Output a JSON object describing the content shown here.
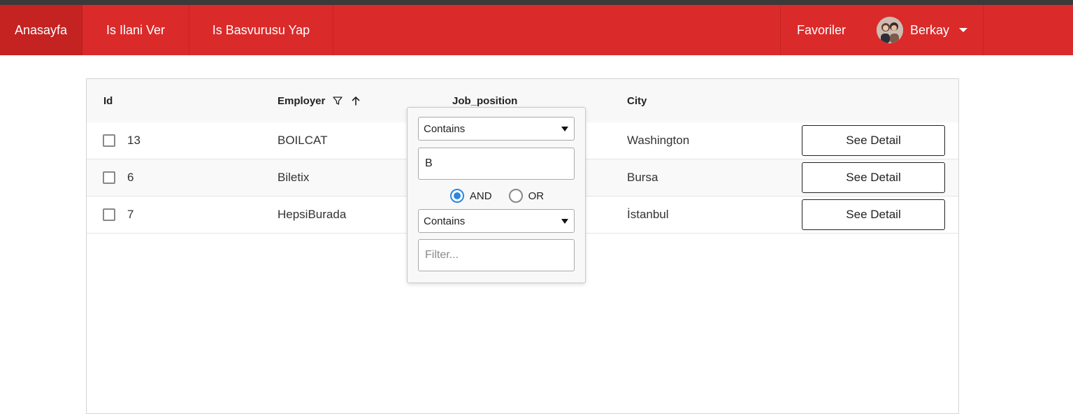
{
  "navbar": {
    "home": "Anasayfa",
    "post_job": "Is Ilani Ver",
    "apply_job": "Is Basvurusu Yap",
    "favorites": "Favoriler",
    "user_name": "Berkay",
    "bg_color": "#db2a2a"
  },
  "table": {
    "columns": {
      "id": "Id",
      "employer": "Employer",
      "job_position": "Job_position",
      "city": "City"
    },
    "rows": [
      {
        "id": "13",
        "employer": "BOILCAT",
        "city": "Washington",
        "action": "See Detail"
      },
      {
        "id": "6",
        "employer": "Biletix",
        "city": "Bursa",
        "action": "See Detail"
      },
      {
        "id": "7",
        "employer": "HepsiBurada",
        "city": "İstanbul",
        "action": "See Detail"
      }
    ],
    "employer_sort": "ascending"
  },
  "filter": {
    "match_mode_1": "Contains",
    "value_1": "B",
    "operator_and": "AND",
    "operator_or": "OR",
    "operator_selected": "AND",
    "match_mode_2": "Contains",
    "placeholder_2": "Filter..."
  }
}
